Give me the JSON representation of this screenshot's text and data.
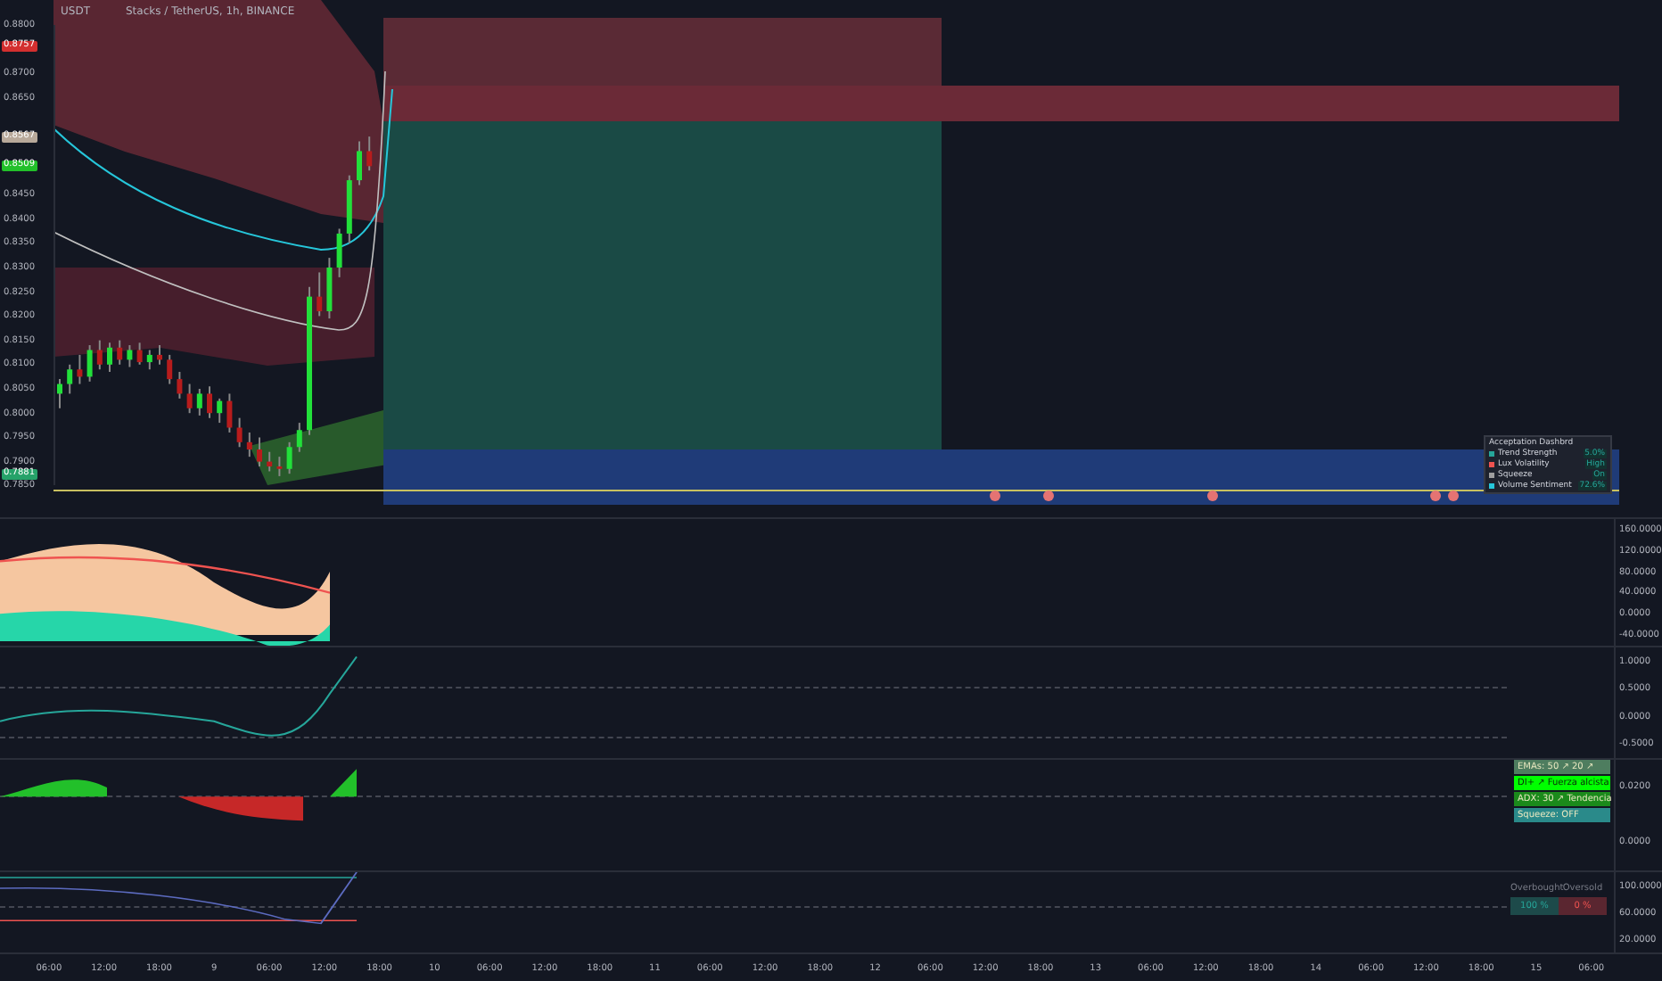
{
  "header": {
    "currency": "USDT",
    "symbol": "Stacks / TetherUS, 1h, BINANCE"
  },
  "price_badges": [
    {
      "text": "0.8757",
      "color": "#d32f2f"
    },
    {
      "text": "0.8567",
      "color": "#b8a99a"
    },
    {
      "text": "0.8509",
      "color": "#22c02a"
    },
    {
      "text": "0.7881",
      "color": "#26a269"
    }
  ],
  "legend": {
    "title": "Acceptation Dashbrd",
    "rows": [
      {
        "label": "Trend Strength",
        "value": "5.0%",
        "color": "#26a69a"
      },
      {
        "label": "Lux Volatility",
        "value": "High",
        "color": "#ef5350"
      },
      {
        "label": "Squeeze",
        "value": "On",
        "color": "#9e9e9e"
      },
      {
        "label": "Volume Sentiment",
        "value": "72.6%",
        "color": "#26c6da"
      }
    ]
  },
  "panes": [
    {
      "axis": [
        "160.0000",
        "120.0000",
        "80.0000",
        "40.0000",
        "0.0000",
        "-40.0000"
      ]
    },
    {
      "axis": [
        "1.0000",
        "0.5000",
        "0.0000",
        "-0.5000"
      ]
    },
    {
      "axis": [
        "0.0200",
        "0.0000"
      ]
    },
    {
      "axis": [
        "100.0000",
        "60.0000",
        "20.0000"
      ]
    }
  ],
  "signal_panel": {
    "rows": [
      {
        "text": "EMAs: 50 ↗ 20 ↗",
        "color": "#4e7d5f"
      },
      {
        "text": "DI+ ↗ Fuerza alcista",
        "color": "#00ff00"
      },
      {
        "text": "ADX: 30 ↗ Tendencia",
        "color": "#1b8a1b"
      },
      {
        "text": "Squeeze: OFF",
        "color": "#2a8a8a"
      }
    ]
  },
  "ob_os": {
    "headers": [
      "Overbought",
      "Oversold"
    ],
    "values": [
      {
        "text": "100 %",
        "color": "#1d4a4a"
      },
      {
        "text": "0 %",
        "color": "#5a2630"
      }
    ]
  },
  "chart_data": {
    "type": "candlestick",
    "ylim": [
      0.785,
      0.88
    ],
    "categories": [
      null,
      null,
      null,
      null,
      null,
      null,
      null,
      null,
      null,
      null,
      null,
      null,
      null,
      null,
      null,
      null,
      null,
      null,
      null,
      null,
      null,
      null,
      null,
      null,
      null,
      null,
      null,
      null,
      null,
      null,
      null,
      null
    ],
    "yticks": [
      {
        "value": 0.88,
        "label": "0.8800"
      },
      {
        "value": 0.87,
        "label": "0.8700"
      },
      {
        "value": 0.865,
        "label": "0.8650"
      },
      {
        "value": 0.845,
        "label": "0.8450"
      },
      {
        "value": 0.84,
        "label": "0.8400"
      },
      {
        "value": 0.835,
        "label": "0.8350"
      },
      {
        "value": 0.83,
        "label": "0.8300"
      },
      {
        "value": 0.825,
        "label": "0.8250"
      },
      {
        "value": 0.82,
        "label": "0.8200"
      },
      {
        "value": 0.815,
        "label": "0.8150"
      },
      {
        "value": 0.81,
        "label": "0.8100"
      },
      {
        "value": 0.805,
        "label": "0.8050"
      },
      {
        "value": 0.8,
        "label": "0.8000"
      },
      {
        "value": 0.795,
        "label": "0.7950"
      },
      {
        "value": 0.79,
        "label": "0.7900"
      },
      {
        "value": 0.785,
        "label": "0.7850"
      }
    ],
    "ohlc": [
      [
        0.804,
        0.807,
        0.801,
        0.806
      ],
      [
        0.806,
        0.81,
        0.804,
        0.809
      ],
      [
        0.809,
        0.812,
        0.806,
        0.8075
      ],
      [
        0.8075,
        0.814,
        0.8065,
        0.813
      ],
      [
        0.813,
        0.815,
        0.809,
        0.81
      ],
      [
        0.81,
        0.8145,
        0.8085,
        0.8135
      ],
      [
        0.8135,
        0.815,
        0.81,
        0.811
      ],
      [
        0.811,
        0.814,
        0.8095,
        0.813
      ],
      [
        0.813,
        0.8145,
        0.81,
        0.8105
      ],
      [
        0.8105,
        0.813,
        0.809,
        0.812
      ],
      [
        0.812,
        0.814,
        0.81,
        0.811
      ],
      [
        0.811,
        0.812,
        0.806,
        0.807
      ],
      [
        0.807,
        0.8085,
        0.803,
        0.804
      ],
      [
        0.804,
        0.806,
        0.8,
        0.801
      ],
      [
        0.801,
        0.805,
        0.7995,
        0.804
      ],
      [
        0.804,
        0.8055,
        0.799,
        0.8
      ],
      [
        0.8,
        0.803,
        0.798,
        0.8025
      ],
      [
        0.8025,
        0.804,
        0.796,
        0.797
      ],
      [
        0.797,
        0.799,
        0.793,
        0.794
      ],
      [
        0.794,
        0.796,
        0.791,
        0.7925
      ],
      [
        0.7925,
        0.795,
        0.789,
        0.79
      ],
      [
        0.79,
        0.792,
        0.788,
        0.789
      ],
      [
        0.789,
        0.791,
        0.787,
        0.7885
      ],
      [
        0.7885,
        0.794,
        0.7875,
        0.793
      ],
      [
        0.793,
        0.798,
        0.792,
        0.7965
      ],
      [
        0.7965,
        0.826,
        0.7955,
        0.824
      ],
      [
        0.824,
        0.829,
        0.82,
        0.821
      ],
      [
        0.821,
        0.832,
        0.8195,
        0.83
      ],
      [
        0.83,
        0.838,
        0.828,
        0.837
      ],
      [
        0.837,
        0.849,
        0.835,
        0.848
      ],
      [
        0.848,
        0.856,
        0.847,
        0.854
      ],
      [
        0.854,
        0.857,
        0.85,
        0.8509
      ]
    ]
  },
  "time_axis": [
    "06:00",
    "12:00",
    "18:00",
    "9",
    "06:00",
    "12:00",
    "18:00",
    "10",
    "06:00",
    "12:00",
    "18:00",
    "11",
    "06:00",
    "12:00",
    "18:00",
    "12",
    "06:00",
    "12:00",
    "18:00",
    "13",
    "06:00",
    "12:00",
    "18:00",
    "14",
    "06:00",
    "12:00",
    "18:00",
    "15",
    "06:00"
  ]
}
